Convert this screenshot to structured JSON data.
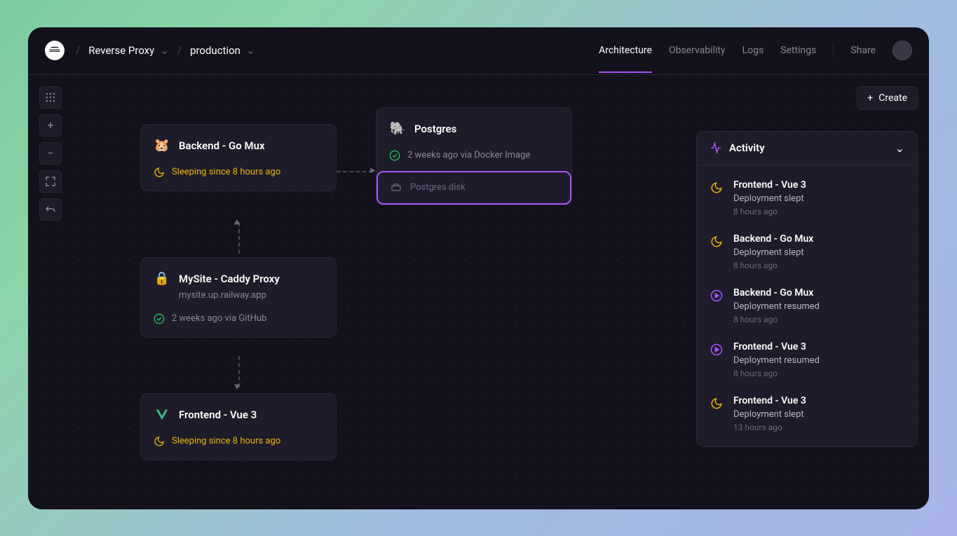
{
  "header": {
    "breadcrumb": {
      "project": "Reverse Proxy",
      "environment": "production"
    },
    "nav": {
      "architecture": "Architecture",
      "observability": "Observability",
      "logs": "Logs",
      "settings": "Settings",
      "share": "Share"
    },
    "create_label": "Create"
  },
  "nodes": {
    "backend": {
      "title": "Backend - Go Mux",
      "status": "Sleeping since 8 hours ago"
    },
    "postgres": {
      "title": "Postgres",
      "status": "2 weeks ago via Docker Image",
      "disk": "Postgres disk"
    },
    "caddy": {
      "title": "MySite - Caddy Proxy",
      "subtitle": "mysite.up.railway.app",
      "status": "2 weeks ago via GitHub"
    },
    "frontend": {
      "title": "Frontend - Vue 3",
      "status": "Sleeping since 8 hours ago"
    }
  },
  "activity": {
    "title": "Activity",
    "items": [
      {
        "icon": "sleep",
        "title": "Frontend - Vue 3",
        "desc": "Deployment slept",
        "time": "8 hours ago"
      },
      {
        "icon": "sleep",
        "title": "Backend - Go Mux",
        "desc": "Deployment slept",
        "time": "8 hours ago"
      },
      {
        "icon": "resume",
        "title": "Backend - Go Mux",
        "desc": "Deployment resumed",
        "time": "8 hours ago"
      },
      {
        "icon": "resume",
        "title": "Frontend - Vue 3",
        "desc": "Deployment resumed",
        "time": "8 hours ago"
      },
      {
        "icon": "sleep",
        "title": "Frontend - Vue 3",
        "desc": "Deployment slept",
        "time": "13 hours ago"
      }
    ]
  }
}
